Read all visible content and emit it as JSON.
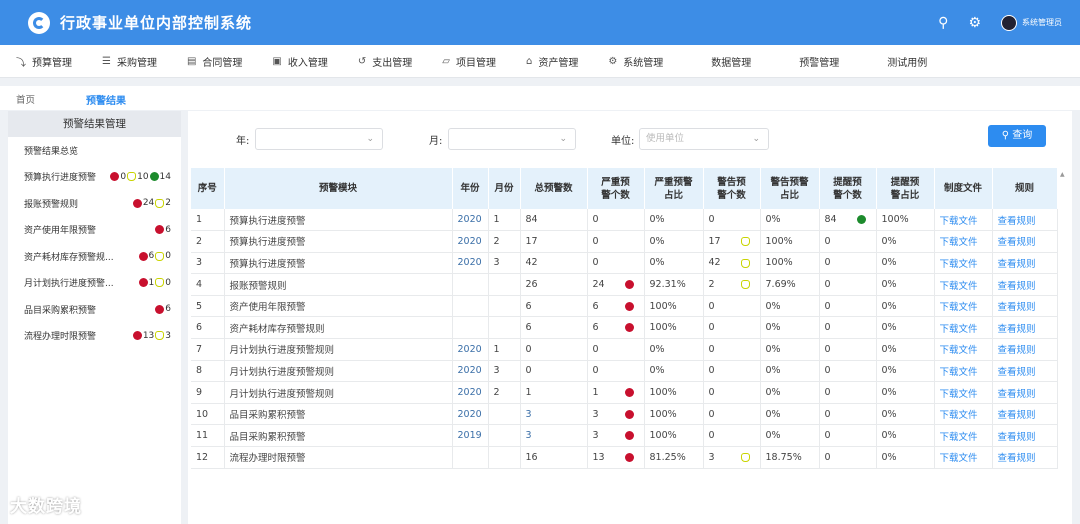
{
  "app": {
    "title": "行政事业单位内部控制系统"
  },
  "topbar": {
    "user_name": "系统管理员",
    "icons": [
      "people-search-icon",
      "gear-icon",
      "avatar"
    ]
  },
  "nav": [
    {
      "label": "预算管理",
      "icon": "chart-line-icon"
    },
    {
      "label": "采购管理",
      "icon": "document-icon"
    },
    {
      "label": "合同管理",
      "icon": "contract-icon"
    },
    {
      "label": "收入管理",
      "icon": "income-icon"
    },
    {
      "label": "支出管理",
      "icon": "expense-icon"
    },
    {
      "label": "项目管理",
      "icon": "folder-icon"
    },
    {
      "label": "资产管理",
      "icon": "home-icon"
    },
    {
      "label": "系统管理",
      "icon": "gear-icon"
    },
    {
      "label": "数据管理",
      "icon": ""
    },
    {
      "label": "预警管理",
      "icon": ""
    },
    {
      "label": "测试用例",
      "icon": ""
    }
  ],
  "breadcrumb": {
    "home": "首页",
    "current": "预警结果"
  },
  "sidebar": {
    "title": "预警结果管理",
    "items": [
      {
        "label": "预警结果总览",
        "badges": []
      },
      {
        "label": "预算执行进度预警",
        "badges": [
          {
            "c": "red",
            "n": "0"
          },
          {
            "c": "yellow",
            "n": "10"
          },
          {
            "c": "green",
            "n": "14"
          }
        ]
      },
      {
        "label": "报账预警规则",
        "badges": [
          {
            "c": "red",
            "n": "24"
          },
          {
            "c": "yellow",
            "n": "2"
          }
        ]
      },
      {
        "label": "资产使用年限预警",
        "badges": [
          {
            "c": "red",
            "n": "6"
          }
        ]
      },
      {
        "label": "资产耗材库存预警规...",
        "badges": [
          {
            "c": "red",
            "n": "6"
          },
          {
            "c": "yellow",
            "n": "0"
          }
        ]
      },
      {
        "label": "月计划执行进度预警...",
        "badges": [
          {
            "c": "red",
            "n": "1"
          },
          {
            "c": "yellow",
            "n": "0"
          }
        ]
      },
      {
        "label": "品目采购累积预警",
        "badges": [
          {
            "c": "red",
            "n": "6"
          }
        ]
      },
      {
        "label": "流程办理时限预警",
        "badges": [
          {
            "c": "red",
            "n": "13"
          },
          {
            "c": "yellow",
            "n": "3"
          }
        ]
      }
    ]
  },
  "filter": {
    "year_label": "年:",
    "month_label": "月:",
    "unit_label": "单位:",
    "unit_placeholder": "使用单位",
    "query_label": "查询"
  },
  "table": {
    "headers": [
      "序号",
      "预警模块",
      "年份",
      "月份",
      "总预警数",
      "严重预警个数",
      "严重预警占比",
      "警告预警个数",
      "警告预警占比",
      "提醒预警个数",
      "提醒预警占比",
      "制度文件",
      "规则"
    ],
    "rows": [
      {
        "no": "1",
        "module": "预算执行进度预警",
        "year": "2020",
        "month": "1",
        "total": "84",
        "sev": "0",
        "sev_dot": "",
        "sev_pct": "0%",
        "warn": "0",
        "warn_dot": "",
        "warn_pct": "0%",
        "rem": "84",
        "rem_dot": "green",
        "rem_pct": "100%",
        "file": "下载文件",
        "rule": "查看规则"
      },
      {
        "no": "2",
        "module": "预算执行进度预警",
        "year": "2020",
        "month": "2",
        "total": "17",
        "sev": "0",
        "sev_dot": "",
        "sev_pct": "0%",
        "warn": "17",
        "warn_dot": "yellow",
        "warn_pct": "100%",
        "rem": "0",
        "rem_dot": "",
        "rem_pct": "0%",
        "file": "下载文件",
        "rule": "查看规则"
      },
      {
        "no": "3",
        "module": "预算执行进度预警",
        "year": "2020",
        "month": "3",
        "total": "42",
        "sev": "0",
        "sev_dot": "",
        "sev_pct": "0%",
        "warn": "42",
        "warn_dot": "yellow",
        "warn_pct": "100%",
        "rem": "0",
        "rem_dot": "",
        "rem_pct": "0%",
        "file": "下载文件",
        "rule": "查看规则"
      },
      {
        "no": "4",
        "module": "报账预警规则",
        "year": "",
        "month": "",
        "total": "26",
        "sev": "24",
        "sev_dot": "red",
        "sev_pct": "92.31%",
        "warn": "2",
        "warn_dot": "yellow",
        "warn_pct": "7.69%",
        "rem": "0",
        "rem_dot": "",
        "rem_pct": "0%",
        "file": "下载文件",
        "rule": "查看规则"
      },
      {
        "no": "5",
        "module": "资产使用年限预警",
        "year": "",
        "month": "",
        "total": "6",
        "sev": "6",
        "sev_dot": "red",
        "sev_pct": "100%",
        "warn": "0",
        "warn_dot": "",
        "warn_pct": "0%",
        "rem": "0",
        "rem_dot": "",
        "rem_pct": "0%",
        "file": "下载文件",
        "rule": "查看规则"
      },
      {
        "no": "6",
        "module": "资产耗材库存预警规则",
        "year": "",
        "month": "",
        "total": "6",
        "sev": "6",
        "sev_dot": "red",
        "sev_pct": "100%",
        "warn": "0",
        "warn_dot": "",
        "warn_pct": "0%",
        "rem": "0",
        "rem_dot": "",
        "rem_pct": "0%",
        "file": "下载文件",
        "rule": "查看规则"
      },
      {
        "no": "7",
        "module": "月计划执行进度预警规则",
        "year": "2020",
        "month": "1",
        "total": "0",
        "sev": "0",
        "sev_dot": "",
        "sev_pct": "0%",
        "warn": "0",
        "warn_dot": "",
        "warn_pct": "0%",
        "rem": "0",
        "rem_dot": "",
        "rem_pct": "0%",
        "file": "下载文件",
        "rule": "查看规则"
      },
      {
        "no": "8",
        "module": "月计划执行进度预警规则",
        "year": "2020",
        "month": "3",
        "total": "0",
        "sev": "0",
        "sev_dot": "",
        "sev_pct": "0%",
        "warn": "0",
        "warn_dot": "",
        "warn_pct": "0%",
        "rem": "0",
        "rem_dot": "",
        "rem_pct": "0%",
        "file": "下载文件",
        "rule": "查看规则"
      },
      {
        "no": "9",
        "module": "月计划执行进度预警规则",
        "year": "2020",
        "month": "2",
        "total": "1",
        "sev": "1",
        "sev_dot": "red",
        "sev_pct": "100%",
        "warn": "0",
        "warn_dot": "",
        "warn_pct": "0%",
        "rem": "0",
        "rem_dot": "",
        "rem_pct": "0%",
        "file": "下载文件",
        "rule": "查看规则"
      },
      {
        "no": "10",
        "module": "品目采购累积预警",
        "year": "2020",
        "month": "",
        "total": "3",
        "sev": "3",
        "sev_dot": "red",
        "sev_pct": "100%",
        "warn": "0",
        "warn_dot": "",
        "warn_pct": "0%",
        "rem": "0",
        "rem_dot": "",
        "rem_pct": "0%",
        "file": "下载文件",
        "rule": "查看规则"
      },
      {
        "no": "11",
        "module": "品目采购累积预警",
        "year": "2019",
        "month": "",
        "total": "3",
        "sev": "3",
        "sev_dot": "red",
        "sev_pct": "100%",
        "warn": "0",
        "warn_dot": "",
        "warn_pct": "0%",
        "rem": "0",
        "rem_dot": "",
        "rem_pct": "0%",
        "file": "下载文件",
        "rule": "查看规则"
      },
      {
        "no": "12",
        "module": "流程办理时限预警",
        "year": "",
        "month": "",
        "total": "16",
        "sev": "13",
        "sev_dot": "red",
        "sev_pct": "81.25%",
        "warn": "3",
        "warn_dot": "yellow",
        "warn_pct": "18.75%",
        "rem": "0",
        "rem_dot": "",
        "rem_pct": "0%",
        "file": "下载文件",
        "rule": "查看规则"
      }
    ]
  },
  "watermark": "大数跨境",
  "colors": {
    "primary": "#3d8de6",
    "link": "#2d8cf0",
    "severe": "#c8102e",
    "warning": "#c9d400",
    "reminder": "#1d8b2d"
  }
}
